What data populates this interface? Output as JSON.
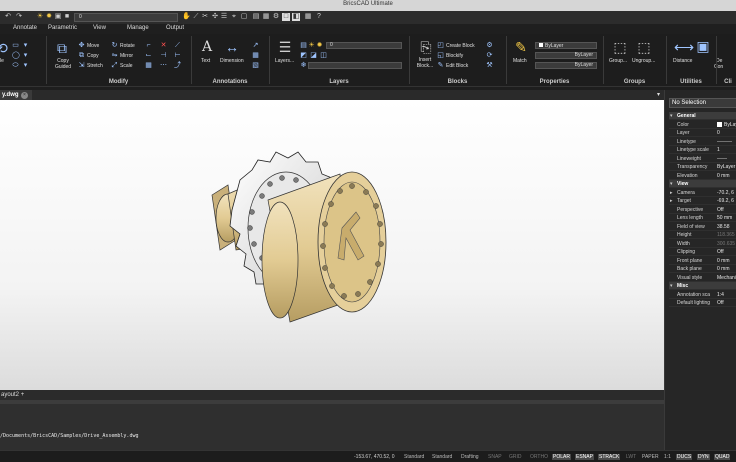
{
  "window": {
    "title": "BricsCAD Ultimate"
  },
  "qat": {
    "layer_value": "0"
  },
  "tabs": [
    "Annotate",
    "Parametric",
    "View",
    "Manage",
    "Output"
  ],
  "ribbon": {
    "modify": {
      "title": "Modify",
      "left_big_label": "le",
      "copy_guided": "Copy Guided",
      "move": "Move",
      "copy": "Copy",
      "stretch": "Stretch",
      "rotate": "Rotate",
      "mirror": "Mirror",
      "scale": "Scale"
    },
    "annotations": {
      "title": "Annotations",
      "text": "Text",
      "dimension": "Dimension"
    },
    "layers": {
      "title": "Layers",
      "layers_btn": "Layers...",
      "layer_value": "0"
    },
    "blocks": {
      "title": "Blocks",
      "insert_block": "Insert Block...",
      "create_block": "Create Block",
      "blockify": "Blockify",
      "edit_block": "Edit Block"
    },
    "properties": {
      "title": "Properties",
      "match": "Match",
      "color": "ByLayer",
      "linetype": "ByLayer",
      "lineweight": "ByLayer"
    },
    "groups": {
      "title": "Groups",
      "group": "Group...",
      "ungroup": "Ungroup..."
    },
    "utilities": {
      "title": "Utilities",
      "distance": "Distance",
      "more": "De",
      "more2": "Con"
    },
    "clipboard": {
      "title": "Cli"
    }
  },
  "document": {
    "tab_label": "y.dwg",
    "layout_tab": "ayout2",
    "add_layout": "+"
  },
  "command": {
    "path": "/Documents/BricsCAD/Samples/Drive_Assembly.dwg"
  },
  "status": {
    "coords": "-153.67, 470.52, 0",
    "items": [
      {
        "label": "Standard",
        "state": "normal"
      },
      {
        "label": "Standard",
        "state": "normal"
      },
      {
        "label": "Drafting",
        "state": "normal"
      },
      {
        "label": "SNAP",
        "state": "off"
      },
      {
        "label": "GRID",
        "state": "off"
      },
      {
        "label": "ORTHO",
        "state": "off"
      },
      {
        "label": "POLAR",
        "state": "on"
      },
      {
        "label": "ESNAP",
        "state": "on"
      },
      {
        "label": "STRACK",
        "state": "on"
      },
      {
        "label": "LWT",
        "state": "off"
      },
      {
        "label": "PAPER",
        "state": "normal"
      },
      {
        "label": "1:1",
        "state": "normal"
      },
      {
        "label": "DUCS",
        "state": "on"
      },
      {
        "label": "DYN",
        "state": "on"
      },
      {
        "label": "QUAD",
        "state": "on"
      }
    ]
  },
  "properties_panel": {
    "selection": "No Selection",
    "sections": [
      {
        "title": "General",
        "rows": [
          {
            "k": "Color",
            "v": "ByLay",
            "swatch": true
          },
          {
            "k": "Layer",
            "v": "0"
          },
          {
            "k": "Linetype",
            "v": "———"
          },
          {
            "k": "Linetype scale",
            "v": "1"
          },
          {
            "k": "Lineweight",
            "v": "——"
          },
          {
            "k": "Transparency",
            "v": "ByLayer"
          },
          {
            "k": "Elevation",
            "v": "0 mm"
          }
        ]
      },
      {
        "title": "View",
        "rows": [
          {
            "k": "Camera",
            "v": "-70.2, 6",
            "arrow": true
          },
          {
            "k": "Target",
            "v": "-69.2, 6",
            "arrow": true
          },
          {
            "k": "Perspective",
            "v": "Off"
          },
          {
            "k": "Lens length",
            "v": "50 mm"
          },
          {
            "k": "Field of view",
            "v": "38.58"
          },
          {
            "k": "Height",
            "v": "118.365",
            "dim": true
          },
          {
            "k": "Width",
            "v": "300.635",
            "dim": true
          },
          {
            "k": "Clipping",
            "v": "Off"
          },
          {
            "k": "Front plane",
            "v": "0 mm"
          },
          {
            "k": "Back plane",
            "v": "0 mm"
          },
          {
            "k": "Visual style",
            "v": "Mechani"
          }
        ]
      },
      {
        "title": "Misc",
        "rows": [
          {
            "k": "Annotation sca",
            "v": "1:4"
          },
          {
            "k": "Default lighting",
            "v": "Off"
          }
        ]
      }
    ]
  }
}
